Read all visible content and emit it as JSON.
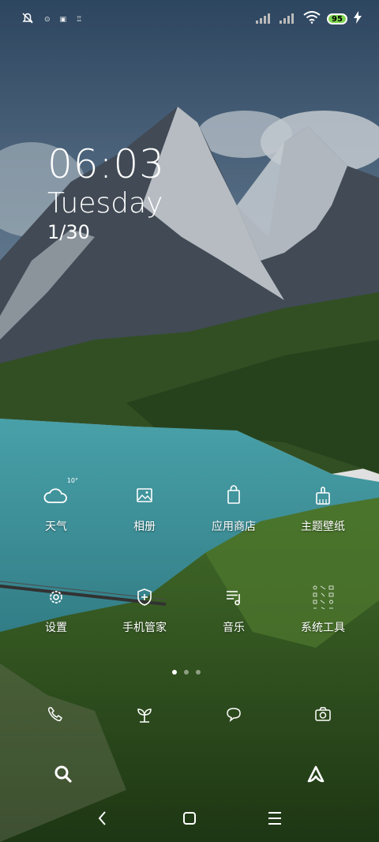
{
  "status_bar": {
    "battery_level": "95",
    "indicators": [
      "muted-bell-icon",
      "notification-icon",
      "notification-icon",
      "notification-icon"
    ],
    "signal_icons": [
      "signal-icon",
      "signal-icon",
      "wifi-icon",
      "charging-icon"
    ]
  },
  "clock": {
    "time": "06:03",
    "day": "Tuesday",
    "date": "1/30"
  },
  "apps": [
    {
      "label": "天气",
      "icon": "weather-icon",
      "temperature": "10°"
    },
    {
      "label": "相册",
      "icon": "gallery-icon"
    },
    {
      "label": "应用商店",
      "icon": "app-store-icon"
    },
    {
      "label": "主题壁纸",
      "icon": "themes-icon"
    },
    {
      "label": "设置",
      "icon": "settings-icon"
    },
    {
      "label": "手机管家",
      "icon": "security-icon"
    },
    {
      "label": "音乐",
      "icon": "music-icon"
    },
    {
      "label": "系统工具",
      "icon": "tools-folder-icon"
    }
  ],
  "page_indicator": {
    "total": 3,
    "active": 1
  },
  "dock": [
    "phone-icon",
    "contacts-icon",
    "messages-icon",
    "camera-icon"
  ],
  "bottom_shortcuts": [
    "search-icon",
    "assistant-icon"
  ],
  "navigation": [
    "back-icon",
    "home-icon",
    "recents-icon"
  ],
  "colors": {
    "battery": "#7cd44e",
    "sky": "#4a6a8a",
    "lake": "#3fa3a8",
    "grass": "#2f5a1f"
  }
}
